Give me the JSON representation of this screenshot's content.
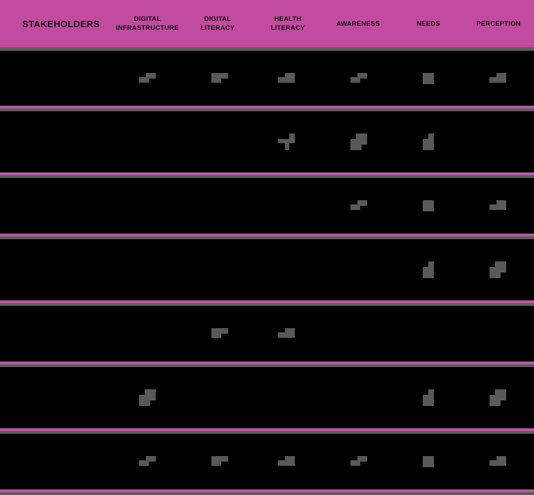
{
  "header": {
    "columns": [
      "STAKEHOLDERS",
      "DIGITAL\nINFRASTRUCTURE",
      "DIGITAL\nLITERACY",
      "HEALTH\nLITERACY",
      "AWARENESS",
      "NEEDS",
      "PERCEPTION"
    ]
  },
  "colors": {
    "header_bg": "#c14c9f",
    "separator_pink": "#b85aa4",
    "separator_grey": "#5d5d5d",
    "mark": "#595959",
    "body_bg": "#000000"
  },
  "rows": [
    {
      "stakeholder": "",
      "marks": [
        "stair-icon",
        "step-down-icon",
        "step-up-icon",
        "stair-icon",
        "square-icon",
        "step-up-icon"
      ]
    },
    {
      "stakeholder": "",
      "marks": [
        "",
        "",
        "cross-step-icon",
        "corner-square-icon",
        "tall-step-icon",
        ""
      ]
    },
    {
      "stakeholder": "",
      "marks": [
        "",
        "",
        "",
        "stair-icon",
        "square-icon",
        "step-up-icon"
      ]
    },
    {
      "stakeholder": "",
      "marks": [
        "",
        "",
        "",
        "",
        "tall-step-icon",
        "corner-square-icon"
      ]
    },
    {
      "stakeholder": "",
      "marks": [
        "",
        "step-down-icon",
        "step-up-icon",
        "",
        "",
        ""
      ]
    },
    {
      "stakeholder": "",
      "marks": [
        "corner-square-icon",
        "",
        "",
        "",
        "tall-step-icon",
        "corner-square-icon"
      ]
    },
    {
      "stakeholder": "",
      "marks": [
        "stair-icon",
        "step-down-icon",
        "step-up-icon",
        "stair-icon",
        "square-icon",
        "step-up-icon"
      ]
    }
  ]
}
